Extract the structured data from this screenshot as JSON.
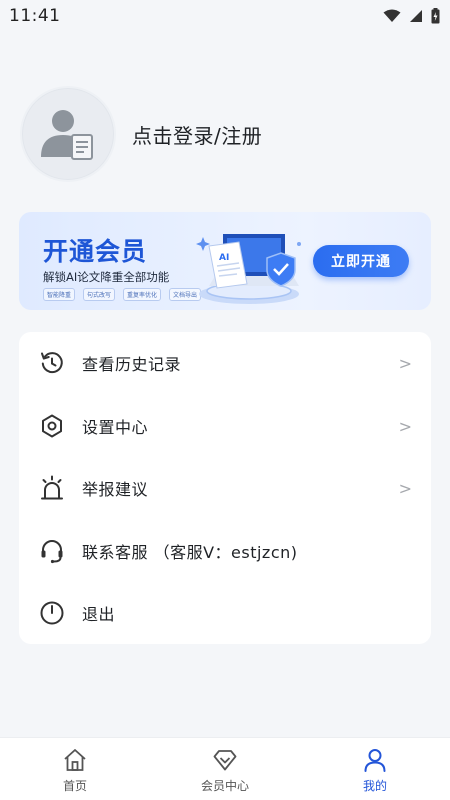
{
  "status_bar": {
    "time": "11:41"
  },
  "profile": {
    "login_text": "点击登录/注册"
  },
  "vip_banner": {
    "title": "开通会员",
    "subtitle": "解锁AI论文降重全部功能",
    "tags": [
      "智能降重",
      "句式改写",
      "重复率优化",
      "文档导出"
    ],
    "illustration_text": "AI",
    "button_label": "立即开通"
  },
  "menu": {
    "items": [
      {
        "label": "查看历史记录",
        "icon": "history-icon",
        "arrow": ">"
      },
      {
        "label": "设置中心",
        "icon": "settings-icon",
        "arrow": ">"
      },
      {
        "label": "举报建议",
        "icon": "alarm-icon",
        "arrow": ">"
      },
      {
        "label": "联系客服 （客服V：estjzcn)",
        "icon": "headset-icon",
        "arrow": ""
      },
      {
        "label": "退出",
        "icon": "power-icon",
        "arrow": ""
      }
    ]
  },
  "bottom_nav": {
    "items": [
      {
        "label": "首页",
        "icon": "home-icon",
        "active": false
      },
      {
        "label": "会员中心",
        "icon": "diamond-icon",
        "active": false
      },
      {
        "label": "我的",
        "icon": "user-icon",
        "active": true
      }
    ]
  },
  "colors": {
    "accent": "#2355d8",
    "banner_button": "#2b6df0",
    "background": "#f4f6f9"
  }
}
